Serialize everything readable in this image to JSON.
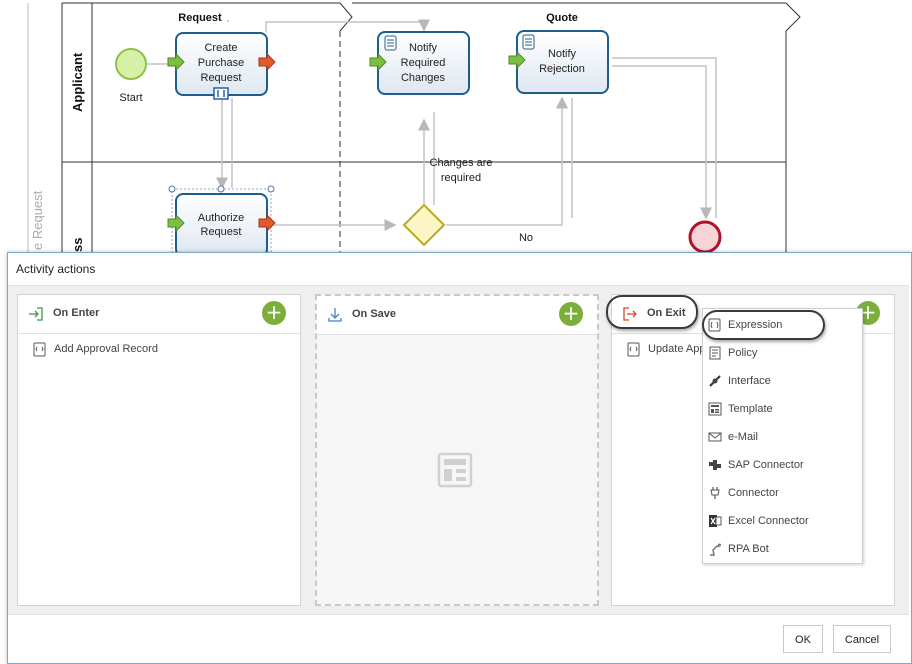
{
  "diagram": {
    "lanes": {
      "applicant": "Applicant",
      "second_lane_partial": "ss",
      "pool_label_partial": "e Request"
    },
    "phases": {
      "request": "Request",
      "quote": "Quote"
    },
    "events": {
      "start": "Start"
    },
    "tasks": {
      "create_purchase_request": [
        "Create",
        "Purchase",
        "Request"
      ],
      "notify_required_changes": [
        "Notify",
        "Required",
        "Changes"
      ],
      "notify_rejection": [
        "Notify",
        "Rejection"
      ],
      "authorize_request": [
        "Authorize",
        "Request"
      ]
    },
    "flow_labels": {
      "changes_required": [
        "Changes are",
        "required"
      ],
      "no": "No"
    }
  },
  "dialog": {
    "title": "Activity actions",
    "panels": {
      "on_enter": {
        "title": "On Enter",
        "add_label": "+",
        "items": [
          {
            "label": "Add Approval Record"
          }
        ]
      },
      "on_save": {
        "title": "On Save",
        "add_label": "+"
      },
      "on_exit": {
        "title": "On Exit",
        "add_label": "+",
        "items": [
          {
            "label": "Update App"
          }
        ]
      }
    },
    "dropdown": {
      "items": [
        {
          "label": "Expression",
          "icon": "expression-icon"
        },
        {
          "label": "Policy",
          "icon": "policy-icon"
        },
        {
          "label": "Interface",
          "icon": "interface-icon"
        },
        {
          "label": "Template",
          "icon": "template-icon"
        },
        {
          "label": "e-Mail",
          "icon": "email-icon"
        },
        {
          "label": "SAP Connector",
          "icon": "sap-connector-icon"
        },
        {
          "label": "Connector",
          "icon": "connector-icon"
        },
        {
          "label": "Excel Connector",
          "icon": "excel-connector-icon"
        },
        {
          "label": "RPA Bot",
          "icon": "rpa-bot-icon"
        }
      ]
    },
    "buttons": {
      "ok": "OK",
      "cancel": "Cancel"
    }
  },
  "colors": {
    "task_border": "#1c5f8d",
    "add_button": "#7bae3a",
    "start_event": "#a8d95a",
    "end_event": "#c0142a",
    "gateway": "#e0d740"
  }
}
